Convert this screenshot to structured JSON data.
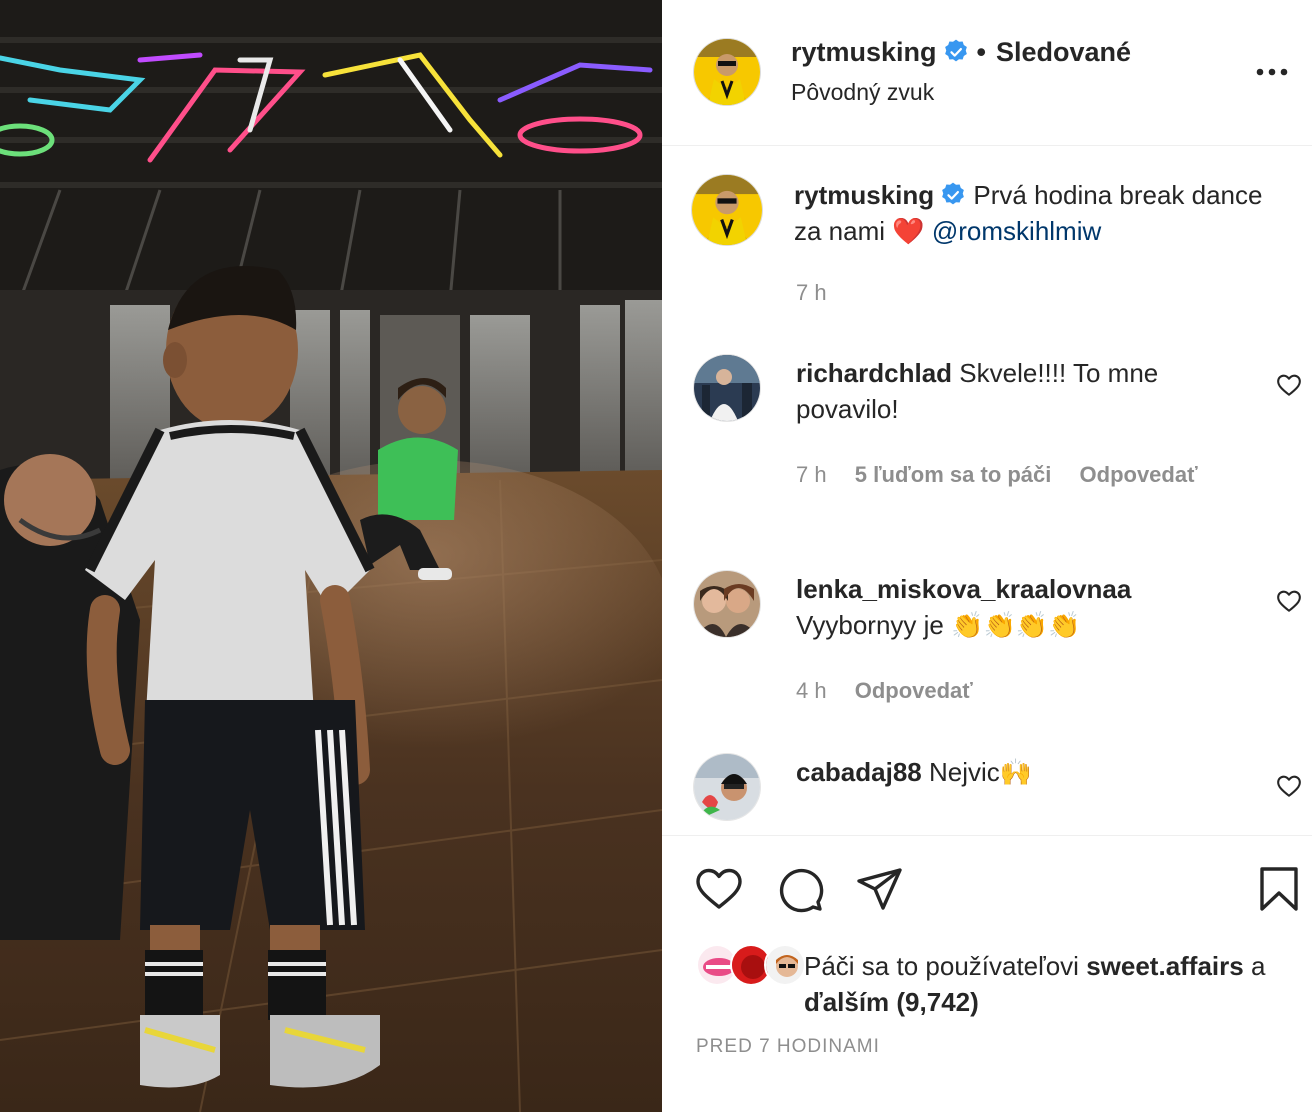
{
  "header": {
    "username": "rytmusking",
    "separator": "•",
    "follow_status": "Sledované",
    "audio": "Pôvodný zvuk"
  },
  "caption": {
    "username": "rytmusking",
    "text": "Prvá hodina break dance za nami ❤️",
    "mention": "@romskihlmiw",
    "time": "7 h"
  },
  "comments": [
    {
      "username": "richardchlad",
      "text": "Skvele!!!! To mne povavilo!",
      "time": "7 h",
      "likes": "5 ľuďom sa to páči",
      "reply": "Odpovedať"
    },
    {
      "username": "lenka_miskova_kraalovnaa",
      "text": "Vyybornyy je 👏👏👏👏",
      "time": "4 h",
      "reply": "Odpovedať"
    },
    {
      "username": "cabadaj88",
      "text": "Nejvic🙌"
    }
  ],
  "likes": {
    "prefix": "Páči sa to používateľovi",
    "user": "sweet.affairs",
    "suffix": "a",
    "others": "ďalším (9,742)"
  },
  "timestamp": "Pred 7 hodinami",
  "icons": {
    "like": "heart-icon",
    "comment": "comment-icon",
    "share": "share-icon",
    "save": "bookmark-icon",
    "more": "more-icon",
    "verified": "verified-badge-icon"
  },
  "colors": {
    "verified": "#3897f0",
    "mention": "#00376b",
    "muted": "#8e8e8e",
    "text": "#262626"
  }
}
